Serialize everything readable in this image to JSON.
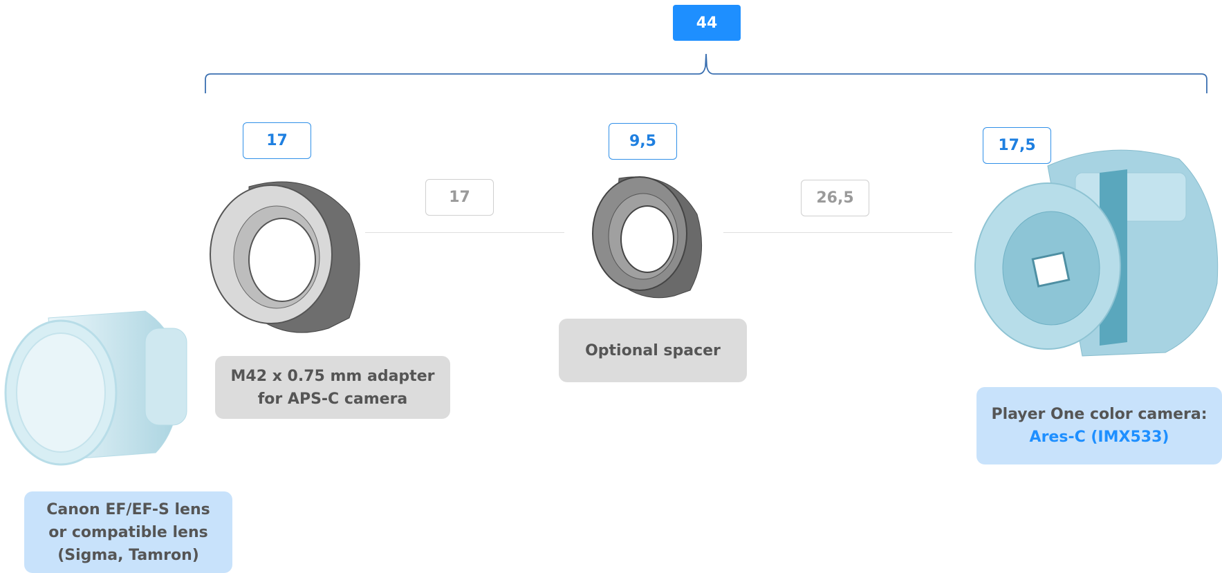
{
  "total": {
    "value": "44"
  },
  "parts": [
    {
      "thickness": "17"
    },
    {
      "thickness": "9,5"
    },
    {
      "thickness": "17,5"
    }
  ],
  "gaps": [
    {
      "value": "17"
    },
    {
      "value": "26,5"
    }
  ],
  "labels": {
    "lens": [
      "Canon EF/EF-S lens",
      "or compatible lens",
      "(Sigma, Tamron)"
    ],
    "adapter": [
      "M42 x 0.75 mm adapter",
      "for APS-C camera"
    ],
    "spacer": "Optional spacer",
    "camera_line1": "Player One color camera:",
    "camera_model": "Ares-C (IMX533)"
  },
  "colors": {
    "accent": "#1e8fff",
    "blue_label_bg": "#c8e2fb",
    "gray_label_bg": "#dcdcdc",
    "bracket": "#3a6fb0"
  }
}
